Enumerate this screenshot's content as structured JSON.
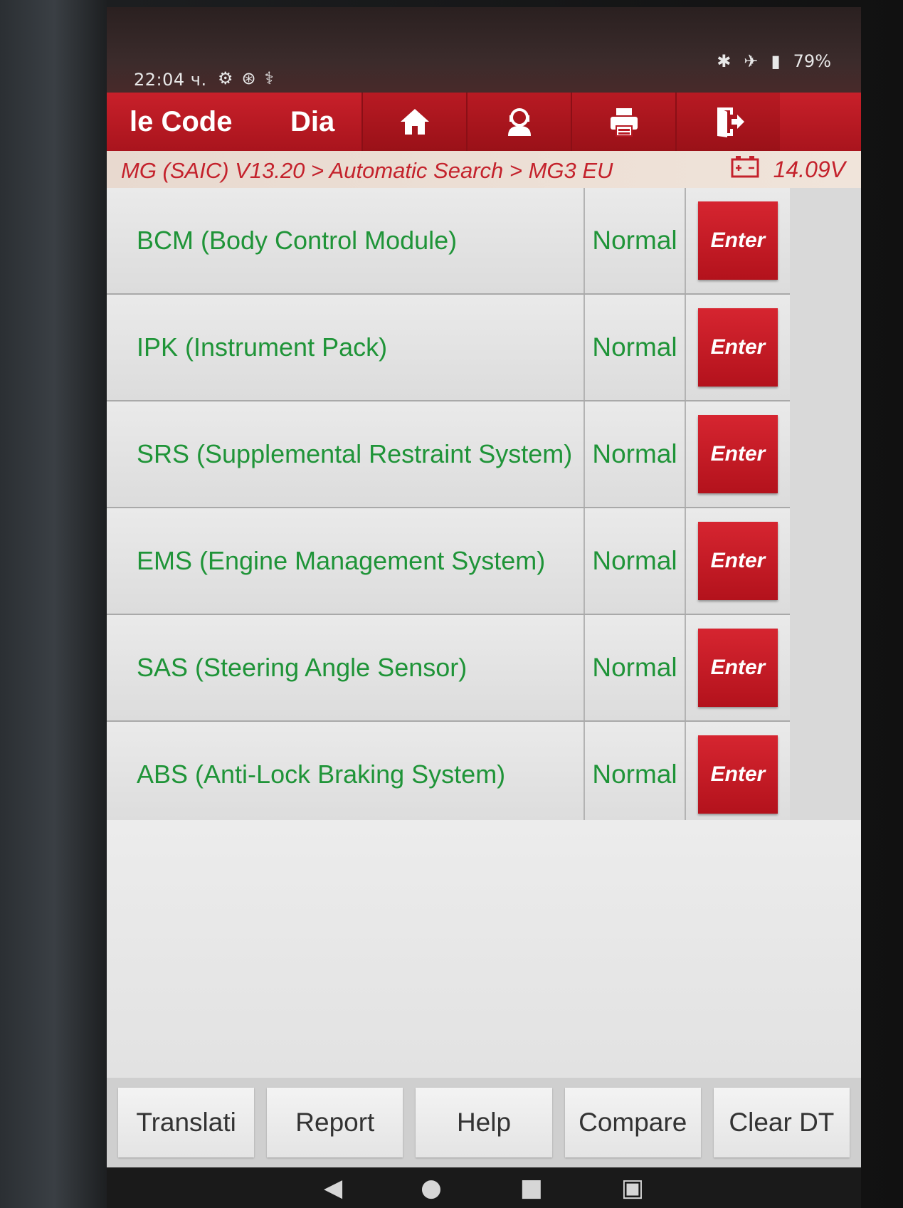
{
  "status_bar": {
    "time": "22:04 ч.",
    "battery": "79%"
  },
  "toolbar": {
    "tabs": [
      {
        "label": "le Code"
      },
      {
        "label": "Dia"
      }
    ],
    "icons": [
      "home-icon",
      "support-icon",
      "print-icon",
      "exit-icon"
    ]
  },
  "breadcrumb": {
    "path": "MG (SAIC) V13.20 > Automatic Search > MG3 EU",
    "voltage": "14.09V"
  },
  "modules": [
    {
      "name": "BCM (Body Control Module)",
      "status": "Normal",
      "action": "Enter"
    },
    {
      "name": "IPK (Instrument Pack)",
      "status": "Normal",
      "action": "Enter"
    },
    {
      "name": "SRS (Supplemental Restraint System)",
      "status": "Normal",
      "action": "Enter"
    },
    {
      "name": "EMS (Engine Management System)",
      "status": "Normal",
      "action": "Enter"
    },
    {
      "name": "SAS (Steering Angle Sensor)",
      "status": "Normal",
      "action": "Enter"
    },
    {
      "name": "ABS (Anti-Lock Braking System)",
      "status": "Normal",
      "action": "Enter"
    }
  ],
  "bottom_buttons": [
    {
      "label": "Translati"
    },
    {
      "label": "Report"
    },
    {
      "label": "Help"
    },
    {
      "label": "Compare"
    },
    {
      "label": "Clear DT"
    }
  ],
  "colors": {
    "accent": "#c8202a",
    "module_text": "#1f9438",
    "breadcrumb_text": "#c4222c"
  }
}
